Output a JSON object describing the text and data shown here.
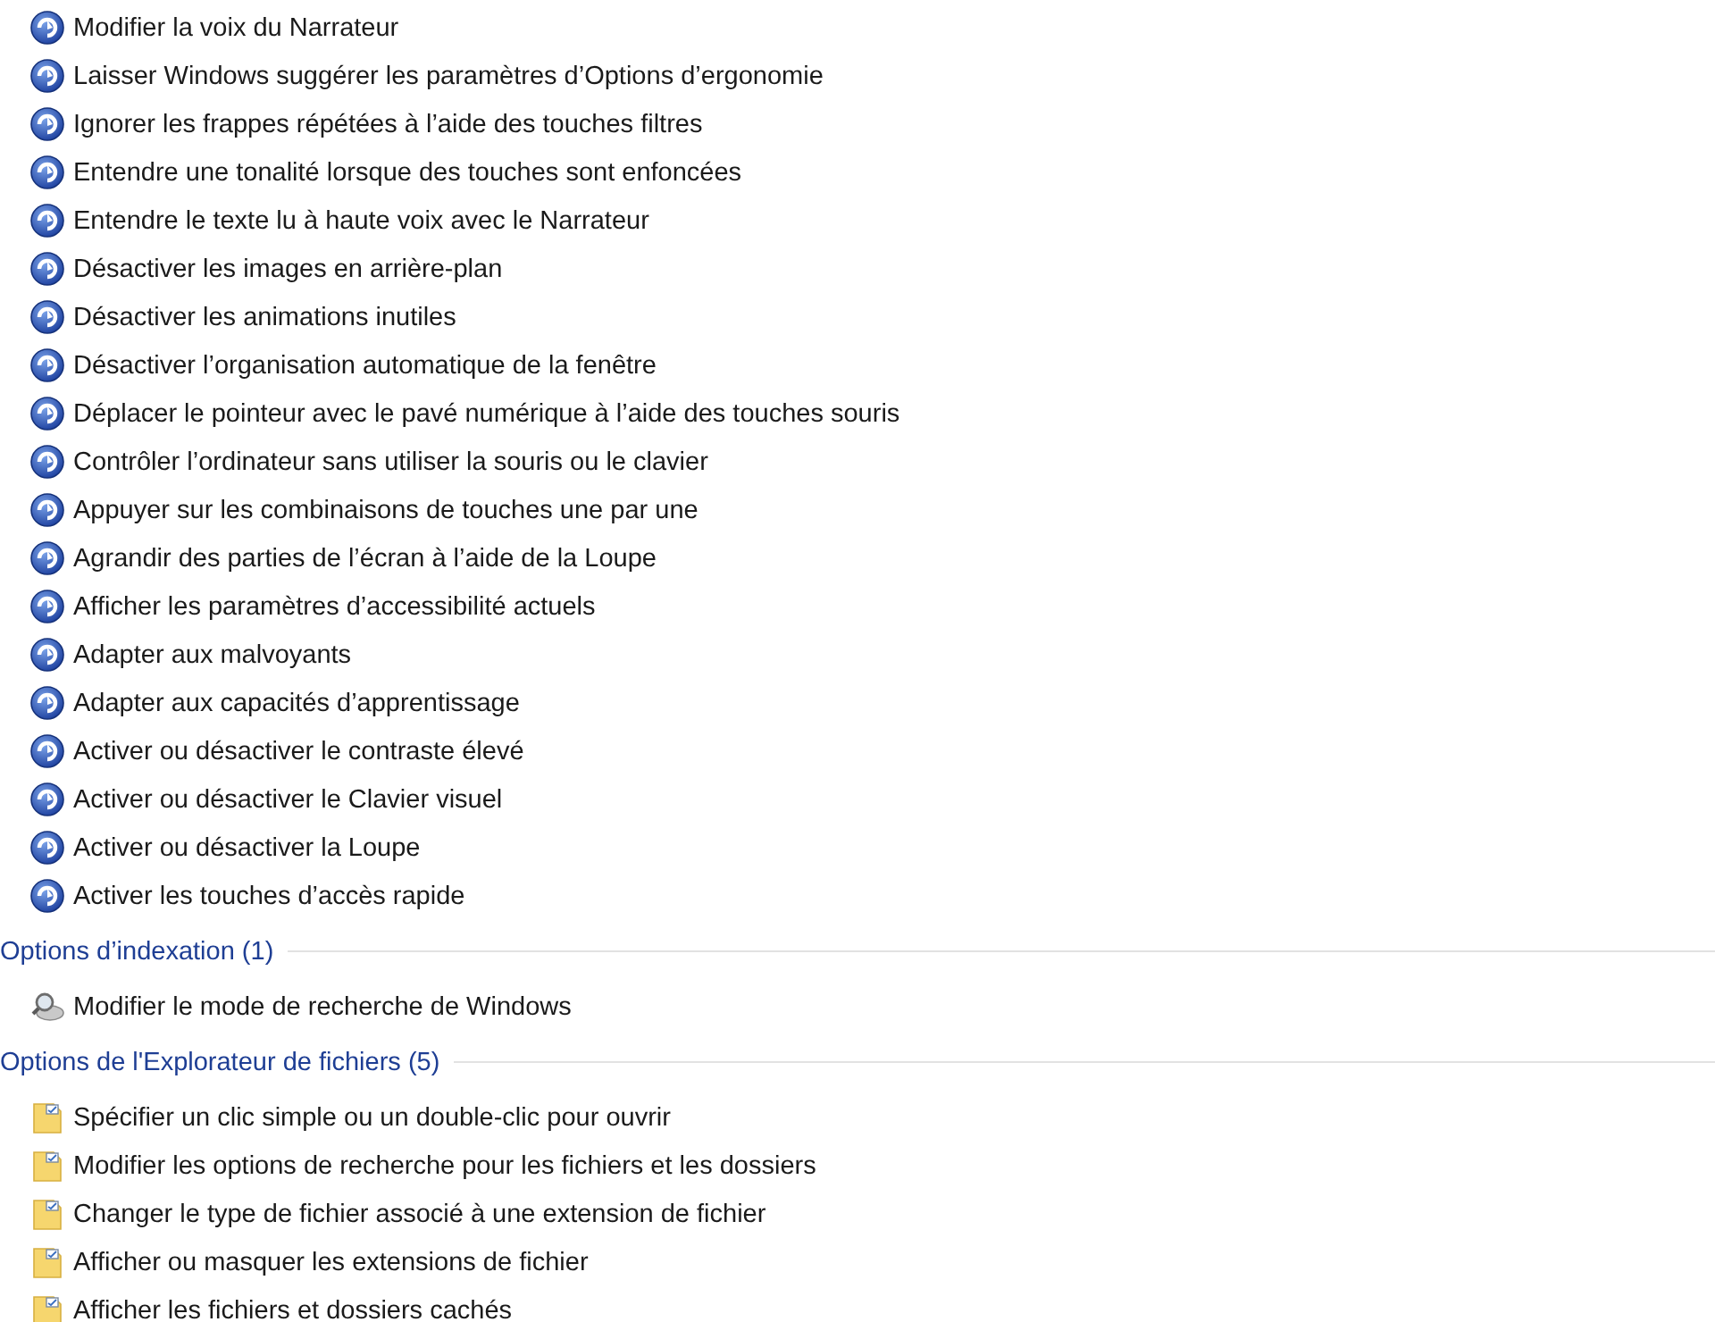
{
  "groups": [
    {
      "items": [
        {
          "kind": "accessibility",
          "label": "Modifier la voix du Narrateur"
        },
        {
          "kind": "accessibility",
          "label": "Laisser Windows suggérer les paramètres d’Options d’ergonomie"
        },
        {
          "kind": "accessibility",
          "label": "Ignorer les frappes répétées à l’aide des touches filtres"
        },
        {
          "kind": "accessibility",
          "label": "Entendre une tonalité lorsque des touches sont enfoncées"
        },
        {
          "kind": "accessibility",
          "label": "Entendre le texte lu à haute voix avec le Narrateur"
        },
        {
          "kind": "accessibility",
          "label": "Désactiver les images en arrière-plan"
        },
        {
          "kind": "accessibility",
          "label": "Désactiver les animations inutiles"
        },
        {
          "kind": "accessibility",
          "label": "Désactiver l’organisation automatique de la fenêtre"
        },
        {
          "kind": "accessibility",
          "label": "Déplacer le pointeur avec le pavé numérique à l’aide des touches souris"
        },
        {
          "kind": "accessibility",
          "label": "Contrôler l’ordinateur sans utiliser la souris ou le clavier"
        },
        {
          "kind": "accessibility",
          "label": "Appuyer sur les combinaisons de touches une par une"
        },
        {
          "kind": "accessibility",
          "label": "Agrandir des parties de l’écran à l’aide de la Loupe"
        },
        {
          "kind": "accessibility",
          "label": "Afficher les paramètres d’accessibilité actuels"
        },
        {
          "kind": "accessibility",
          "label": "Adapter aux malvoyants"
        },
        {
          "kind": "accessibility",
          "label": "Adapter aux capacités d’apprentissage"
        },
        {
          "kind": "accessibility",
          "label": "Activer ou désactiver le contraste élevé"
        },
        {
          "kind": "accessibility",
          "label": "Activer ou désactiver le Clavier visuel"
        },
        {
          "kind": "accessibility",
          "label": "Activer ou désactiver la Loupe"
        },
        {
          "kind": "accessibility",
          "label": "Activer les touches d’accès rapide"
        }
      ]
    },
    {
      "header": "Options d’indexation (1)",
      "items": [
        {
          "kind": "indexing",
          "label": "Modifier le mode de recherche de Windows"
        }
      ]
    },
    {
      "header": "Options de l'Explorateur de fichiers (5)",
      "items": [
        {
          "kind": "folder-options",
          "label": "Spécifier un clic simple ou un double-clic pour ouvrir"
        },
        {
          "kind": "folder-options",
          "label": "Modifier les options de recherche pour les fichiers et les dossiers"
        },
        {
          "kind": "folder-options",
          "label": "Changer le type de fichier associé à une extension de fichier"
        },
        {
          "kind": "folder-options",
          "label": "Afficher ou masquer les extensions de fichier"
        },
        {
          "kind": "folder-options",
          "label": "Afficher les fichiers et dossiers cachés"
        }
      ]
    }
  ]
}
